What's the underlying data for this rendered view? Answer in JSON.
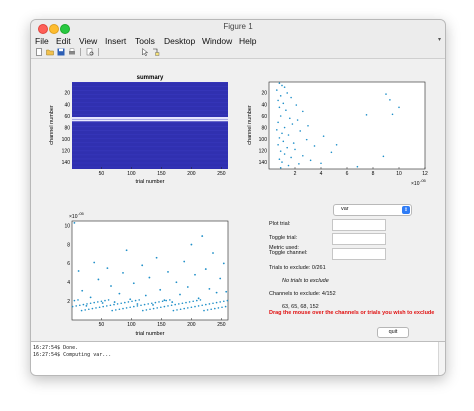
{
  "window": {
    "title": "Figure 1"
  },
  "menu": [
    "File",
    "Edit",
    "View",
    "Insert",
    "Tools",
    "Desktop",
    "Window",
    "Help"
  ],
  "toolbar": {
    "icons": [
      "new-figure-icon",
      "open-file-icon",
      "save-icon",
      "print-icon",
      "print-preview-icon",
      "edit-plot-arrow-icon",
      "data-cursor-icon"
    ]
  },
  "summary_title": "summary",
  "axes_labels": {
    "channel": "channel number",
    "trial": "trial number",
    "exp_right": "×10",
    "exp_right_pow": "-05",
    "exp_left": "×10",
    "exp_left_pow": "-05"
  },
  "controls": {
    "metric_label": "Metric used:",
    "metric_value": "var",
    "plot_trial_label": "Plot trial:",
    "toggle_trial_label": "Toggle trial:",
    "toggle_channel_label": "Toggle channel:",
    "trials_exclude": "Trials to exclude: 0/261",
    "no_trials": "No trials to exclude",
    "channels_exclude": "Channels to exclude: 4/152",
    "channels_list": "63, 65, 68, 152",
    "warning": "Drag the mouse over the channels or trials you wish to exclude",
    "quit": "quit"
  },
  "console": [
    "16:27:54$ Done.",
    "16:27:54$ Computing var..."
  ],
  "colors": {
    "heatmap_bg": "#3030b0",
    "dot": "#1f8fc8",
    "warning": "#e01010",
    "accent": "#2f7cf6"
  },
  "chart_data": [
    {
      "type": "heatmap",
      "title": "summary",
      "xlabel": "trial number",
      "ylabel": "channel number",
      "x_ticks": [
        50,
        100,
        150,
        200,
        250
      ],
      "y_ticks": [
        20,
        40,
        60,
        80,
        100,
        120,
        140
      ],
      "xlim": [
        1,
        261
      ],
      "ylim": [
        1,
        152
      ],
      "highlighted_channels": [
        63,
        65,
        68
      ]
    },
    {
      "type": "scatter",
      "xlabel": "",
      "ylabel": "channel number",
      "x_ticks": [
        2,
        4,
        6,
        8,
        10,
        12
      ],
      "y_ticks": [
        20,
        40,
        60,
        80,
        100,
        120,
        140
      ],
      "x_exponent": "×10^-05",
      "xlim": [
        0,
        12
      ],
      "ylim": [
        1,
        152
      ],
      "points": [
        [
          0.8,
          3
        ],
        [
          1.0,
          7
        ],
        [
          1.2,
          10
        ],
        [
          0.6,
          15
        ],
        [
          1.4,
          20
        ],
        [
          0.9,
          25
        ],
        [
          1.7,
          28
        ],
        [
          0.7,
          33
        ],
        [
          1.1,
          38
        ],
        [
          2.1,
          41
        ],
        [
          0.8,
          45
        ],
        [
          1.3,
          50
        ],
        [
          2.6,
          52
        ],
        [
          9.5,
          57
        ],
        [
          0.9,
          60
        ],
        [
          1.6,
          64
        ],
        [
          2.2,
          67
        ],
        [
          0.7,
          71
        ],
        [
          1.8,
          74
        ],
        [
          3.0,
          77
        ],
        [
          1.2,
          80
        ],
        [
          0.6,
          84
        ],
        [
          2.4,
          86
        ],
        [
          1.0,
          90
        ],
        [
          1.5,
          93
        ],
        [
          4.2,
          95
        ],
        [
          0.8,
          98
        ],
        [
          2.9,
          101
        ],
        [
          1.1,
          104
        ],
        [
          1.9,
          107
        ],
        [
          0.7,
          110
        ],
        [
          3.5,
          112
        ],
        [
          1.4,
          115
        ],
        [
          2.0,
          118
        ],
        [
          0.9,
          121
        ],
        [
          4.8,
          123
        ],
        [
          1.2,
          126
        ],
        [
          2.6,
          129
        ],
        [
          1.7,
          132
        ],
        [
          0.8,
          135
        ],
        [
          3.2,
          137
        ],
        [
          1.0,
          140
        ],
        [
          2.3,
          143
        ],
        [
          1.5,
          146
        ],
        [
          6.8,
          148
        ],
        [
          0.9,
          150
        ],
        [
          9.0,
          22
        ],
        [
          9.3,
          32
        ],
        [
          10.0,
          45
        ],
        [
          7.5,
          58
        ],
        [
          5.2,
          110
        ],
        [
          8.8,
          130
        ],
        [
          4.0,
          142
        ]
      ]
    },
    {
      "type": "scatter",
      "xlabel": "trial number",
      "ylabel": "",
      "x_ticks": [
        50,
        100,
        150,
        200,
        250
      ],
      "y_ticks": [
        2,
        4,
        6,
        8,
        10
      ],
      "y_exponent": "×10^-05",
      "xlim": [
        1,
        261
      ],
      "ylim": [
        0,
        10.5
      ],
      "points": [
        [
          5,
          10.3
        ],
        [
          12,
          5.2
        ],
        [
          18,
          3.1
        ],
        [
          25,
          1.5
        ],
        [
          32,
          2.4
        ],
        [
          38,
          6.1
        ],
        [
          45,
          4.3
        ],
        [
          52,
          1.8
        ],
        [
          60,
          5.5
        ],
        [
          66,
          3.6
        ],
        [
          72,
          1.9
        ],
        [
          80,
          2.8
        ],
        [
          86,
          5.0
        ],
        [
          92,
          7.4
        ],
        [
          98,
          2.2
        ],
        [
          104,
          3.9
        ],
        [
          110,
          1.7
        ],
        [
          118,
          5.8
        ],
        [
          124,
          2.6
        ],
        [
          130,
          4.5
        ],
        [
          136,
          1.6
        ],
        [
          142,
          6.6
        ],
        [
          148,
          3.2
        ],
        [
          155,
          2.1
        ],
        [
          161,
          5.1
        ],
        [
          168,
          1.9
        ],
        [
          175,
          4.0
        ],
        [
          181,
          2.7
        ],
        [
          188,
          6.2
        ],
        [
          194,
          3.5
        ],
        [
          200,
          8.0
        ],
        [
          206,
          4.8
        ],
        [
          212,
          2.3
        ],
        [
          218,
          8.9
        ],
        [
          224,
          5.4
        ],
        [
          230,
          3.3
        ],
        [
          236,
          7.1
        ],
        [
          242,
          2.9
        ],
        [
          248,
          4.4
        ],
        [
          254,
          6.0
        ],
        [
          258,
          3.0
        ]
      ]
    }
  ]
}
